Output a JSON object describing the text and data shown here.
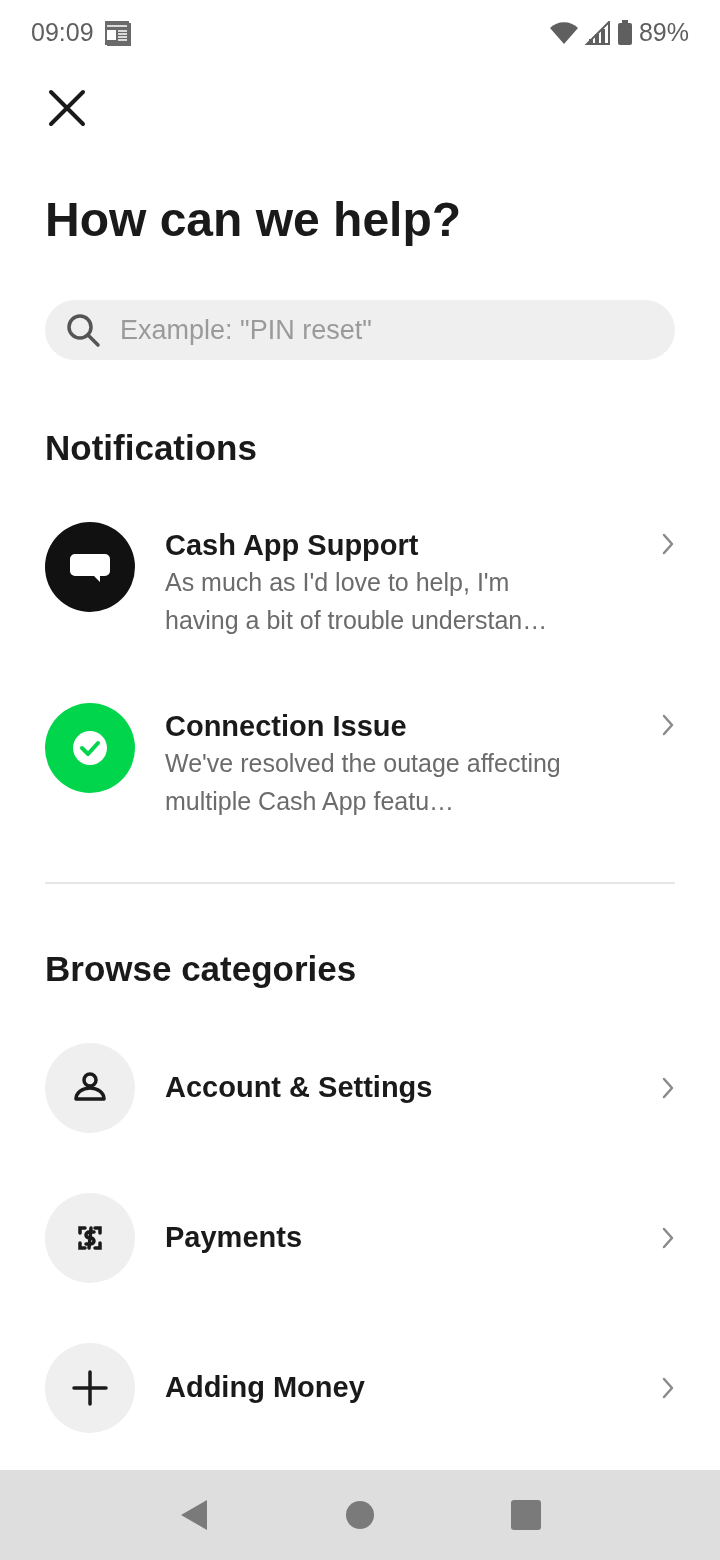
{
  "status_bar": {
    "time": "09:09",
    "battery": "89%"
  },
  "title": "How can we help?",
  "search": {
    "placeholder": "Example: \"PIN reset\""
  },
  "notifications": {
    "heading": "Notifications",
    "items": [
      {
        "kind": "chat",
        "color": "#111111",
        "title": "Cash App Support",
        "message": "As much as I'd love to help, I'm having a bit of trouble understan…"
      },
      {
        "kind": "check",
        "color": "#00d54b",
        "title": "Connection Issue",
        "message": "We've resolved the outage affecting multiple Cash App featu…"
      }
    ]
  },
  "categories": {
    "heading": "Browse categories",
    "items": [
      {
        "kind": "person",
        "label": "Account & Settings"
      },
      {
        "kind": "dollar",
        "label": "Payments"
      },
      {
        "kind": "plus",
        "label": "Adding Money"
      }
    ]
  }
}
